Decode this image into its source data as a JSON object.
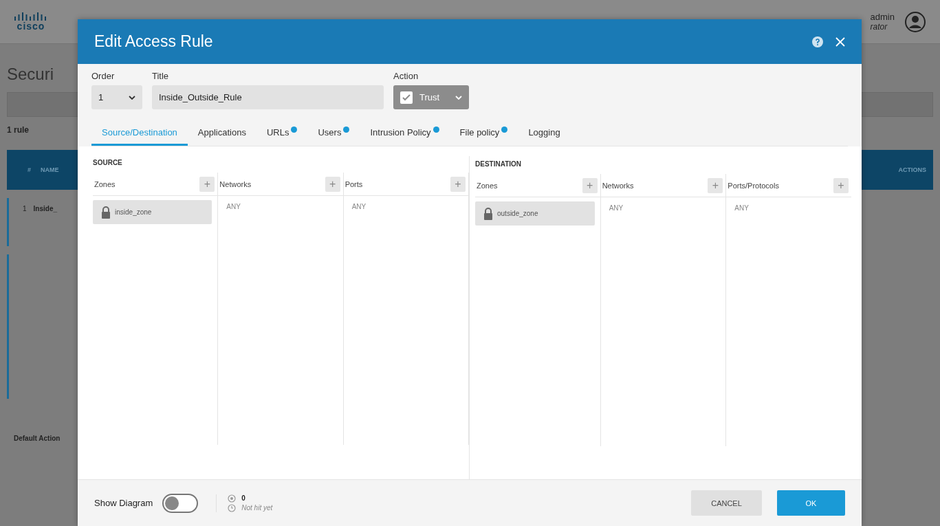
{
  "background": {
    "logo": "cisco",
    "user": "admin",
    "role": "rator",
    "page_title": "Securi",
    "rule_count": "1 rule",
    "table": {
      "columns": [
        "#",
        "NAME",
        "ACTIONS"
      ],
      "row": {
        "number": "1",
        "name": "Inside_"
      }
    },
    "default_action": "Default Action"
  },
  "dialog": {
    "title": "Edit Access Rule",
    "form": {
      "order": {
        "label": "Order",
        "value": "1"
      },
      "title": {
        "label": "Title",
        "value": "Inside_Outside_Rule"
      },
      "action": {
        "label": "Action",
        "value": "Trust",
        "checked": true
      }
    },
    "tabs": [
      {
        "label": "Source/Destination",
        "selected": true,
        "info": false
      },
      {
        "label": "Applications",
        "selected": false,
        "info": false
      },
      {
        "label": "URLs",
        "selected": false,
        "info": true
      },
      {
        "label": "Users",
        "selected": false,
        "info": true
      },
      {
        "label": "Intrusion Policy",
        "selected": false,
        "info": true
      },
      {
        "label": "File policy",
        "selected": false,
        "info": true
      },
      {
        "label": "Logging",
        "selected": false,
        "info": false
      }
    ],
    "sections": [
      {
        "title": "SOURCE",
        "columns": [
          {
            "label": "Zones",
            "add": "+",
            "items": [
              {
                "kind": "zone",
                "text": "inside_zone"
              }
            ]
          },
          {
            "label": "Networks",
            "add": "+",
            "items": [
              {
                "kind": "any",
                "text": "ANY"
              }
            ]
          },
          {
            "label": "Ports",
            "add": "+",
            "items": [
              {
                "kind": "any",
                "text": "ANY"
              }
            ]
          }
        ]
      },
      {
        "title": "DESTINATION",
        "columns": [
          {
            "label": "Zones",
            "add": "+",
            "items": [
              {
                "kind": "zone",
                "text": "outside_zone"
              }
            ]
          },
          {
            "label": "Networks",
            "add": "+",
            "items": [
              {
                "kind": "any",
                "text": "ANY"
              }
            ]
          },
          {
            "label": "Ports/Protocols",
            "add": "+",
            "items": [
              {
                "kind": "any",
                "text": "ANY"
              }
            ]
          }
        ]
      }
    ],
    "footer": {
      "show_diagram": {
        "label": "Show Diagram",
        "on": false
      },
      "hits": "0",
      "last_hit": "Not hit yet",
      "buttons": [
        {
          "label": "CANCEL",
          "kind": "secondary"
        },
        {
          "label": "OK",
          "kind": "primary"
        }
      ]
    }
  }
}
